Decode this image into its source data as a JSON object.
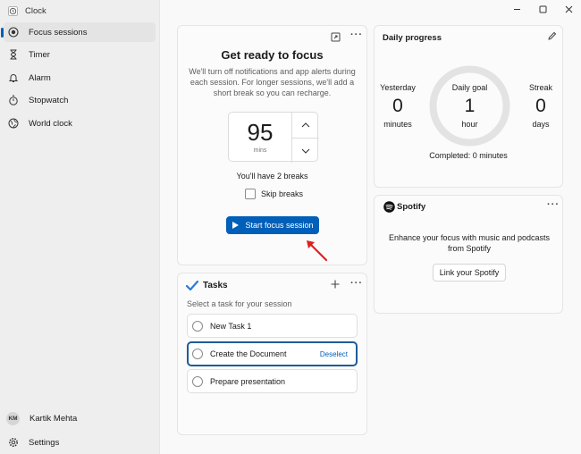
{
  "app": {
    "title": "Clock",
    "window_controls": [
      "minimize",
      "maximize",
      "close"
    ]
  },
  "sidebar": {
    "items": [
      {
        "label": "Focus sessions",
        "icon": "focus-icon",
        "active": true
      },
      {
        "label": "Timer",
        "icon": "hourglass-icon"
      },
      {
        "label": "Alarm",
        "icon": "bell-icon"
      },
      {
        "label": "Stopwatch",
        "icon": "stopwatch-icon"
      },
      {
        "label": "World clock",
        "icon": "globe-icon"
      }
    ],
    "user": {
      "initials": "KM",
      "name": "Kartik Mehta"
    },
    "settings_label": "Settings"
  },
  "focus": {
    "title": "Get ready to focus",
    "description": "We'll turn off notifications and app alerts during each session. For longer sessions, we'll add a short break so you can recharge.",
    "duration_value": "95",
    "duration_unit": "mins",
    "breaks_text": "You'll have 2 breaks",
    "skip_breaks_label": "Skip breaks",
    "skip_breaks_checked": false,
    "start_label": "Start focus session"
  },
  "tasks": {
    "title": "Tasks",
    "hint": "Select a task for your session",
    "items": [
      {
        "label": "New Task 1",
        "selected": false
      },
      {
        "label": "Create the Document",
        "selected": true,
        "action": "Deselect"
      },
      {
        "label": "Prepare presentation",
        "selected": false
      }
    ]
  },
  "daily_progress": {
    "title": "Daily progress",
    "yesterday": {
      "label": "Yesterday",
      "value": "0",
      "unit": "minutes"
    },
    "goal": {
      "label": "Daily goal",
      "value": "1",
      "unit": "hour"
    },
    "streak": {
      "label": "Streak",
      "value": "0",
      "unit": "days"
    },
    "completed_text": "Completed: 0 minutes"
  },
  "spotify": {
    "brand": "Spotify",
    "description": "Enhance your focus with music and podcasts from Spotify",
    "link_label": "Link your Spotify"
  },
  "colors": {
    "accent": "#005fb8",
    "annotation_arrow": "#e02020"
  }
}
